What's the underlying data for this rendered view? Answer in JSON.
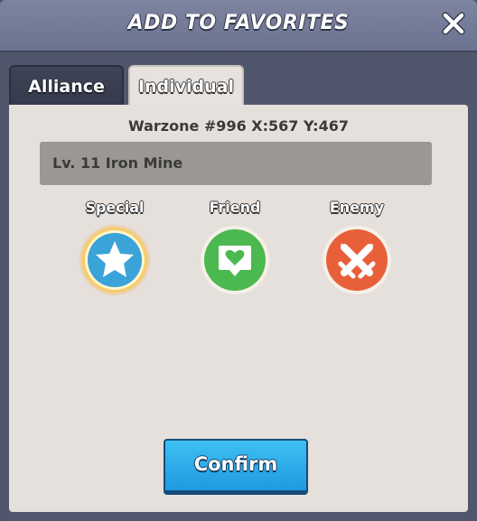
{
  "dialog": {
    "title": "ADD TO FAVORITES"
  },
  "tabs": {
    "alliance": "Alliance",
    "individual": "Individual",
    "active": "individual"
  },
  "location": {
    "coords": "Warzone #996 X:567 Y:467",
    "name": "Lv. 11 Iron Mine"
  },
  "categories": [
    {
      "label": "Special",
      "icon": "star-icon",
      "color": "#3aa3d8",
      "selected": true
    },
    {
      "label": "Friend",
      "icon": "heart-speech-icon",
      "color": "#4cb850",
      "selected": false
    },
    {
      "label": "Enemy",
      "icon": "crossed-swords-icon",
      "color": "#e8603a",
      "selected": false
    }
  ],
  "confirm_label": "Confirm",
  "colors": {
    "panel_bg": "#e6e0dc",
    "confirm": "#2aaeea",
    "selection_glow": "#ffd53a"
  }
}
